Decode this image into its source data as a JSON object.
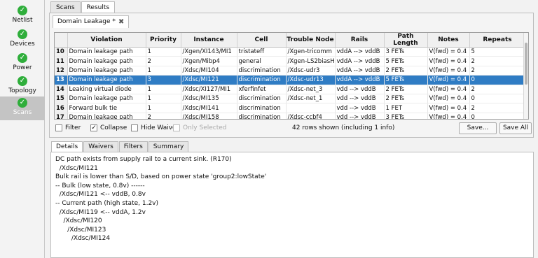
{
  "sidebar": {
    "items": [
      {
        "label": "Netlist"
      },
      {
        "label": "Devices"
      },
      {
        "label": "Power"
      },
      {
        "label": "Topology"
      },
      {
        "label": "Scans"
      }
    ]
  },
  "top_tabs": [
    {
      "label": "Scans"
    },
    {
      "label": "Results"
    }
  ],
  "doc_tab": {
    "label": "Domain Leakage *",
    "close_icon": "✖"
  },
  "table": {
    "headers": [
      "Violation",
      "Priority",
      "Instance",
      "Cell",
      "Trouble Node",
      "Rails",
      "Path Length",
      "Notes",
      "Repeats"
    ],
    "rows": [
      {
        "n": "10",
        "violation": "Domain leakage path",
        "priority": "1",
        "instance": "/Xgen/XI143/MI1",
        "cell": "tristateff",
        "node": "/Xgen-tricomm",
        "rails": "vddA --> vddB",
        "path": "3 FETs",
        "notes": "V(fwd) = 0.4",
        "repeats": "5"
      },
      {
        "n": "11",
        "violation": "Domain leakage path",
        "priority": "2",
        "instance": "/Xgen/Mibp4",
        "cell": "general",
        "node": "/Xgen-LS2biasH",
        "rails": "vddA --> vddB",
        "path": "5 FETs",
        "notes": "V(fwd) = 0.4",
        "repeats": "2"
      },
      {
        "n": "12",
        "violation": "Domain leakage path",
        "priority": "1",
        "instance": "/Xdsc/MI104",
        "cell": "discrimination",
        "node": "/Xdsc-udr3",
        "rails": "vddA --> vddB",
        "path": "2 FETs",
        "notes": "V(fwd) = 0.4",
        "repeats": "2"
      },
      {
        "n": "13",
        "violation": "Domain leakage path",
        "priority": "3",
        "instance": "/Xdsc/MI121",
        "cell": "discrimination",
        "node": "/Xdsc-udr13",
        "rails": "vddA --> vddB",
        "path": "5 FETs",
        "notes": "V(fwd) = 0.4",
        "repeats": "0"
      },
      {
        "n": "14",
        "violation": "Leaking virtual diode",
        "priority": "1",
        "instance": "/Xdsc/XI127/MI1",
        "cell": "xferfinfet",
        "node": "/Xdsc-net_3",
        "rails": "vdd --> vddB",
        "path": "2 FETs",
        "notes": "V(fwd) = 0.4",
        "repeats": "2"
      },
      {
        "n": "15",
        "violation": "Domain leakage path",
        "priority": "1",
        "instance": "/Xdsc/MI135",
        "cell": "discrimination",
        "node": "/Xdsc-net_1",
        "rails": "vdd --> vddB",
        "path": "2 FETs",
        "notes": "V(fwd) = 0.4",
        "repeats": "0"
      },
      {
        "n": "16",
        "violation": "Forward bulk tie",
        "priority": "1",
        "instance": "/Xdsc/MI141",
        "cell": "discrimination",
        "node": "",
        "rails": "vdd --> vddB",
        "path": "1 FET",
        "notes": "V(fwd) = 0.4",
        "repeats": "2"
      },
      {
        "n": "17",
        "violation": "Domain leakage path",
        "priority": "2",
        "instance": "/Xdsc/MI158",
        "cell": "discrimination",
        "node": "/Xdsc-ccbf4",
        "rails": "vdd --> vddB",
        "path": "3 FETs",
        "notes": "V(fwd) = 0.4",
        "repeats": "0"
      }
    ],
    "selected_row": "13"
  },
  "filter_bar": {
    "filter_label": "Filter",
    "collapse_label": "Collapse",
    "hide_waived_label": "Hide Waived",
    "only_selected_label": "Only Selected",
    "rows_shown": "42 rows shown (including 1 info)",
    "save_label": "Save...",
    "save_all_label": "Save All"
  },
  "lower_tabs": [
    {
      "label": "Details"
    },
    {
      "label": "Waivers"
    },
    {
      "label": "Filters"
    },
    {
      "label": "Summary"
    }
  ],
  "details": {
    "lines": [
      "DC path exists from supply rail to a current sink. (R170)",
      "  /Xdsc/MI121",
      "Bulk rail is lower than S/D, based on power state 'group2:lowState'",
      "-- Bulk (low state, 0.8v) ------",
      "  /Xdsc/MI121 <-- vddB, 0.8v",
      "-- Current path (high state, 1.2v)",
      "  /Xdsc/MI119 <-- vddA, 1.2v",
      "    /Xdsc/MI120",
      "      /Xdsc/MI123",
      "        /Xdsc/MI124"
    ]
  },
  "colors": {
    "selection": "#2f7cc4",
    "check": "#2fae3b",
    "active_nav": "#c4c4c4"
  }
}
